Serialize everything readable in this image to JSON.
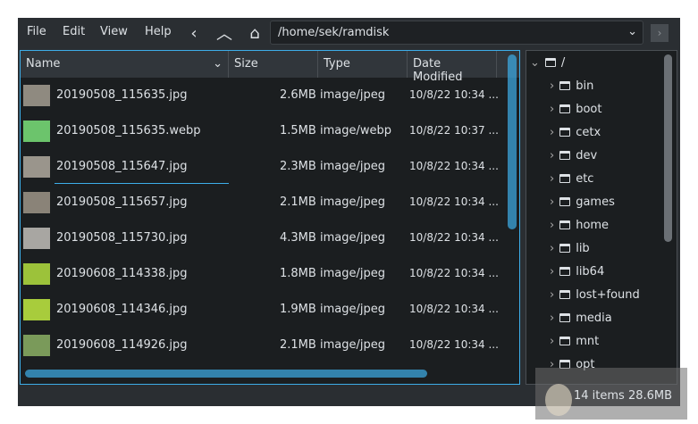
{
  "menu": [
    "File",
    "Edit",
    "View",
    "Help"
  ],
  "path": "/home/sek/ramdisk",
  "columns": [
    "Name",
    "Size",
    "Type",
    "Date Modified"
  ],
  "files": [
    {
      "name": "20190508_115635.jpg",
      "size": "2.6MB",
      "type": "image/jpeg",
      "date": "10/8/22 10:34 ...",
      "thumb": "#8f8a80"
    },
    {
      "name": "20190508_115635.webp",
      "size": "1.5MB",
      "type": "image/webp",
      "date": "10/8/22 10:37 ...",
      "thumb": "#6cc46c"
    },
    {
      "name": "20190508_115647.jpg",
      "size": "2.3MB",
      "type": "image/jpeg",
      "date": "10/8/22 10:34 ...",
      "thumb": "#9a958c"
    },
    {
      "name": "20190508_115657.jpg",
      "size": "2.1MB",
      "type": "image/jpeg",
      "date": "10/8/22 10:34 ...",
      "thumb": "#8a8378"
    },
    {
      "name": "20190508_115730.jpg",
      "size": "4.3MB",
      "type": "image/jpeg",
      "date": "10/8/22 10:34 ...",
      "thumb": "#a8a6a2"
    },
    {
      "name": "20190608_114338.jpg",
      "size": "1.8MB",
      "type": "image/jpeg",
      "date": "10/8/22 10:34 ...",
      "thumb": "#9cc23a"
    },
    {
      "name": "20190608_114346.jpg",
      "size": "1.9MB",
      "type": "image/jpeg",
      "date": "10/8/22 10:34 ...",
      "thumb": "#a8cc3c"
    },
    {
      "name": "20190608_114926.jpg",
      "size": "2.1MB",
      "type": "image/jpeg",
      "date": "10/8/22 10:34 ...",
      "thumb": "#7a9a5a"
    }
  ],
  "tree": [
    "/",
    "bin",
    "boot",
    "cetx",
    "dev",
    "etc",
    "games",
    "home",
    "lib",
    "lib64",
    "lost+found",
    "media",
    "mnt",
    "opt"
  ],
  "status": "14 items  28.6MB"
}
